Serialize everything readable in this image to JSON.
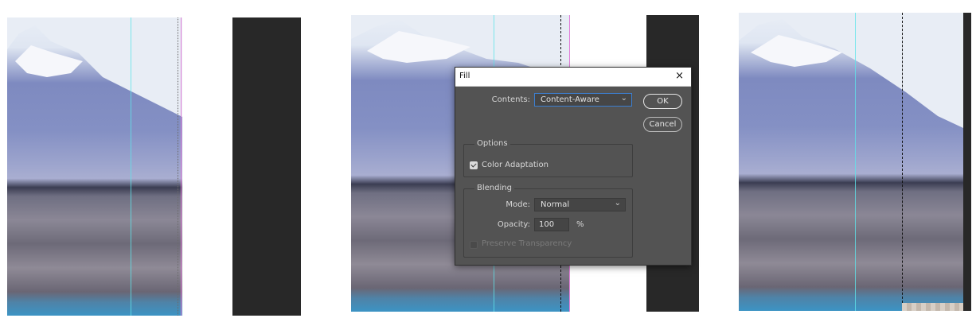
{
  "dialog": {
    "title": "Fill",
    "close_glyph": "×",
    "contents_label": "Contents:",
    "contents_value": "Content-Aware",
    "ok_label": "OK",
    "cancel_label": "Cancel",
    "options_title": "Options",
    "color_adaptation_label": "Color Adaptation",
    "color_adaptation_checked": true,
    "blending_title": "Blending",
    "mode_label": "Mode:",
    "mode_value": "Normal",
    "opacity_label": "Opacity:",
    "opacity_value": "100",
    "opacity_unit": "%",
    "preserve_label": "Preserve Transparency",
    "preserve_checked": false,
    "chevron_glyph": "⌄"
  },
  "colors": {
    "dialog_bg": "#535353",
    "focus_blue": "#3c7fd1",
    "guide_cyan": "#5fe3ea",
    "guide_magenta": "#e07fd8",
    "dark_bar": "#282828"
  }
}
